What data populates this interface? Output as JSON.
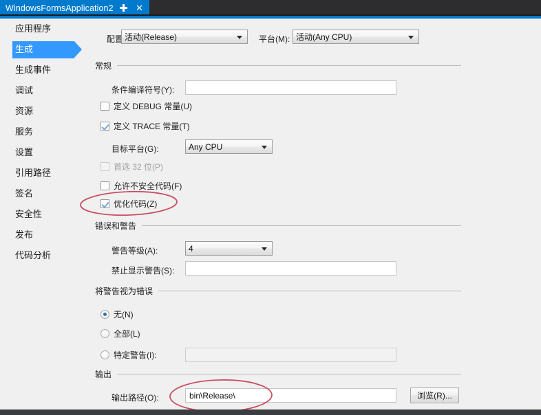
{
  "titlebar": {
    "tab_label": "WindowsFormsApplication2",
    "pin_icon": "pin-icon",
    "close_icon": "close-icon",
    "accent_color": "#007acc",
    "background_color": "#2d2d30"
  },
  "sidebar": {
    "selected_index": 1,
    "items": [
      {
        "label": "应用程序"
      },
      {
        "label": "生成"
      },
      {
        "label": "生成事件"
      },
      {
        "label": "调试"
      },
      {
        "label": "资源"
      },
      {
        "label": "服务"
      },
      {
        "label": "设置"
      },
      {
        "label": "引用路径"
      },
      {
        "label": "签名"
      },
      {
        "label": "安全性"
      },
      {
        "label": "发布"
      },
      {
        "label": "代码分析"
      }
    ],
    "selected_color": "#3399ff"
  },
  "toolbar": {
    "configuration_label": "配置(C):",
    "configuration_value": "活动(Release)",
    "platform_label": "平台(M):",
    "platform_value": "活动(Any CPU)"
  },
  "general": {
    "section_label": "常规",
    "conditional_symbols_label": "条件编译符号(Y):",
    "conditional_symbols_value": "",
    "define_debug_label": "定义 DEBUG 常量(U)",
    "define_debug_checked": false,
    "define_trace_label": "定义 TRACE 常量(T)",
    "define_trace_checked": true,
    "target_platform_label": "目标平台(G):",
    "target_platform_value": "Any CPU",
    "prefer_32bit_label": "首选 32 位(P)",
    "prefer_32bit_checked": false,
    "prefer_32bit_disabled": true,
    "allow_unsafe_label": "允许不安全代码(F)",
    "allow_unsafe_checked": false,
    "optimize_code_label": "优化代码(Z)",
    "optimize_code_checked": true
  },
  "errors_warnings": {
    "section_label": "错误和警告",
    "warning_level_label": "警告等级(A):",
    "warning_level_value": "4",
    "suppress_warnings_label": "禁止显示警告(S):",
    "suppress_warnings_value": ""
  },
  "treat_warnings": {
    "section_label": "将警告视为错误",
    "none_label": "无(N)",
    "all_label": "全部(L)",
    "specific_label": "特定警告(I):",
    "specific_value": "",
    "selected": "none"
  },
  "output": {
    "section_label": "输出",
    "output_path_label": "输出路径(O):",
    "output_path_value": "bin\\Release\\",
    "browse_label": "浏览(R)..."
  },
  "annotations": {
    "color": "#c94f63",
    "ellipse_1_target": "优化代码(Z)",
    "ellipse_2_target": "bin\\Release\\"
  }
}
